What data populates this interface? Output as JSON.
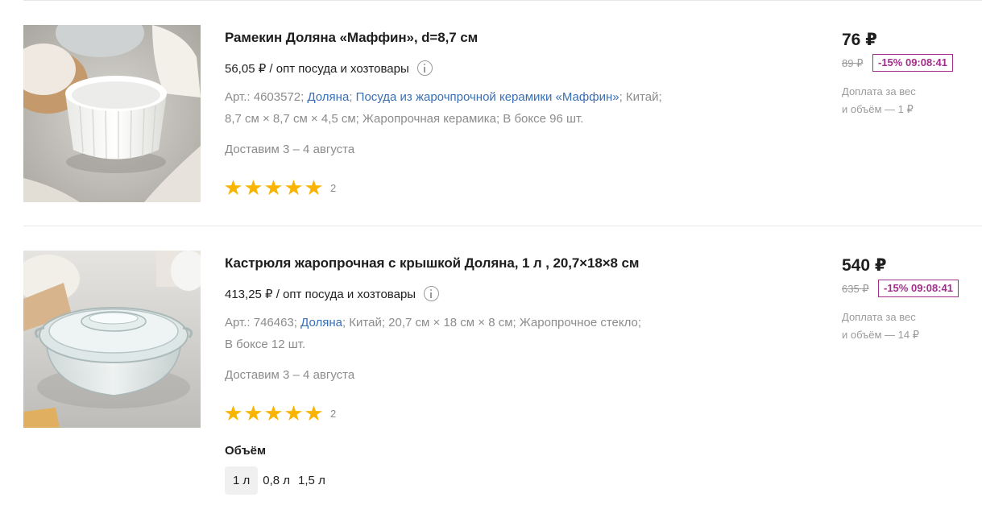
{
  "products": [
    {
      "title": "Рамекин Доляна «Маффин», d=8,7 см",
      "wholesale": "56,05 ₽ / опт посуда и хозтовары",
      "article": "Арт.: 4603572;",
      "brand": "Доляна",
      "collection": "Посуда из жарочпрочной керамики «Маффин»",
      "specs_rest_1": "; Китай;",
      "specs_rest_2": "8,7 см × 8,7 см × 4,5 см; Жаропрочная керамика; В боксе 96 шт.",
      "delivery": "Доставим 3 – 4 августа",
      "rating": 5,
      "rating_count": "2",
      "price": "76 ₽",
      "old_price": "89 ₽",
      "promo": "-15% 09:08:41",
      "extra_1": "Доплата за вес",
      "extra_2": "и объём — 1 ₽"
    },
    {
      "title": "Кастрюля жаропрочная с крышкой Доляна, 1 л , 20,7×18×8 см",
      "wholesale": "413,25 ₽ / опт посуда и хозтовары",
      "article": "Арт.: 746463;",
      "brand": "Доляна",
      "specs_rest_1": "; Китай; 20,7 см × 18 см × 8 см; Жаропрочное стекло;",
      "specs_rest_2": "В боксе 12 шт.",
      "delivery": "Доставим 3 – 4 августа",
      "rating": 5,
      "rating_count": "2",
      "price": "540 ₽",
      "old_price": "635 ₽",
      "promo": "-15% 09:08:41",
      "extra_1": "Доплата за вес",
      "extra_2": "и объём — 14 ₽",
      "volume_label": "Объём",
      "volume_options": [
        "1 л",
        "0,8 л",
        "1,5 л"
      ],
      "volume_selected": "1 л"
    }
  ],
  "colors": {
    "accent_link": "#3a6fb4",
    "promo": "#a12f8a",
    "star": "#f9b400"
  }
}
